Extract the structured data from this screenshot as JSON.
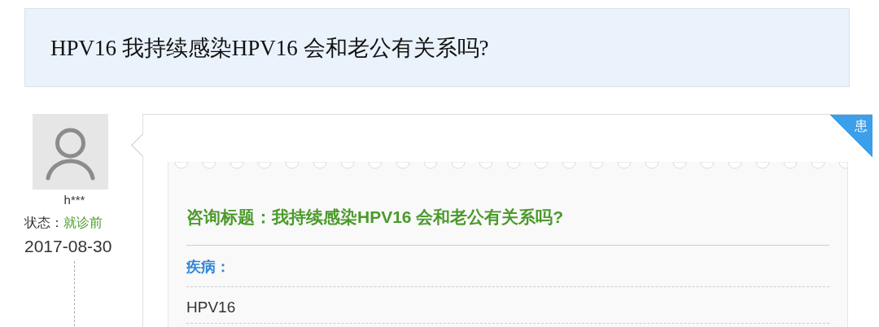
{
  "page_title": "HPV16 我持续感染HPV16 会和老公有关系吗?",
  "author": {
    "name": "h***",
    "status_label": "状态：",
    "status_value": "就诊前",
    "date": "2017-08-30"
  },
  "question": {
    "badge": "患",
    "title": "咨询标题：我持续感染HPV16 会和老公有关系吗?",
    "fields": [
      {
        "label": "疾病：",
        "value": "HPV16"
      }
    ]
  }
}
